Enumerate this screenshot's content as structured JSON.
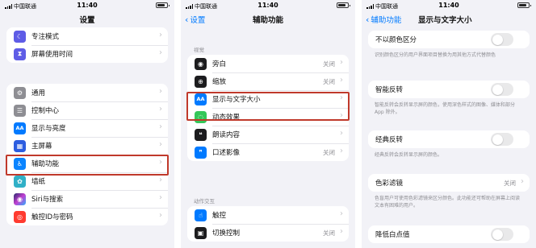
{
  "status": {
    "carrier": "中国联通",
    "time": "11:40"
  },
  "panel1": {
    "title": "设置",
    "group_top": [
      {
        "label": "专注模式",
        "icon": "moon-icon",
        "color": "#5e5ce6"
      },
      {
        "label": "屏幕使用时间",
        "icon": "hourglass-icon",
        "color": "#5e5ce6"
      }
    ],
    "group_main": [
      {
        "label": "通用",
        "icon": "gear-icon",
        "color": "#8e8e93"
      },
      {
        "label": "控制中心",
        "icon": "toggles-icon",
        "color": "#8e8e93"
      },
      {
        "label": "显示与亮度",
        "icon": "aa-icon",
        "color": "#007aff"
      },
      {
        "label": "主屏幕",
        "icon": "grid-icon",
        "color": "#2c5de0"
      },
      {
        "label": "辅助功能",
        "icon": "accessibility-icon",
        "color": "#0a84ff"
      },
      {
        "label": "墙纸",
        "icon": "flower-icon",
        "color": "#30b0c7"
      },
      {
        "label": "Siri与搜索",
        "icon": "siri-icon",
        "color": "#222222"
      },
      {
        "label": "触控ID与密码",
        "icon": "fingerprint-icon",
        "color": "#ff3b30"
      }
    ]
  },
  "panel2": {
    "back": "设置",
    "title": "辅助功能",
    "section_vision": "视觉",
    "vision": [
      {
        "label": "旁白",
        "value": "关闭",
        "icon": "voiceover-icon",
        "color": "#1c1c1e"
      },
      {
        "label": "缩放",
        "value": "关闭",
        "icon": "zoom-icon",
        "color": "#1c1c1e"
      },
      {
        "label": "显示与文字大小",
        "value": "",
        "icon": "aa-icon",
        "color": "#007aff"
      },
      {
        "label": "动态效果",
        "value": "",
        "icon": "motion-icon",
        "color": "#34c759"
      },
      {
        "label": "朗读内容",
        "value": "",
        "icon": "speech-icon",
        "color": "#1c1c1e"
      },
      {
        "label": "口述影像",
        "value": "关闭",
        "icon": "quote-icon",
        "color": "#007aff"
      }
    ],
    "section_interaction": "动作交互",
    "interaction": [
      {
        "label": "触控",
        "value": "",
        "icon": "hand-icon",
        "color": "#007aff"
      },
      {
        "label": "切换控制",
        "value": "关闭",
        "icon": "switch-icon",
        "color": "#1c1c1e"
      }
    ]
  },
  "panel3": {
    "back": "辅助功能",
    "title": "显示与文字大小",
    "items": [
      {
        "label": "不以颜色区分",
        "note": "识别颜色区分的用户界面项目替换为用其他方式代替颜色",
        "toggle": "off"
      },
      {
        "label": "智能反转",
        "note": "智能反转会反转显示屏的颜色，使用深色样式的图像、媒体和部分 App 除外。",
        "toggle": "off"
      },
      {
        "label": "经典反转",
        "note": "经典反转会反转显示屏的颜色。",
        "toggle": "off"
      },
      {
        "label": "色彩滤镜",
        "value": "关闭",
        "note": "色盲用户可使用色彩滤镜来区分颜色。此功能还可帮助在屏幕上阅读文本有困难的用户。"
      },
      {
        "label": "降低白点值",
        "toggle": "off"
      }
    ]
  }
}
